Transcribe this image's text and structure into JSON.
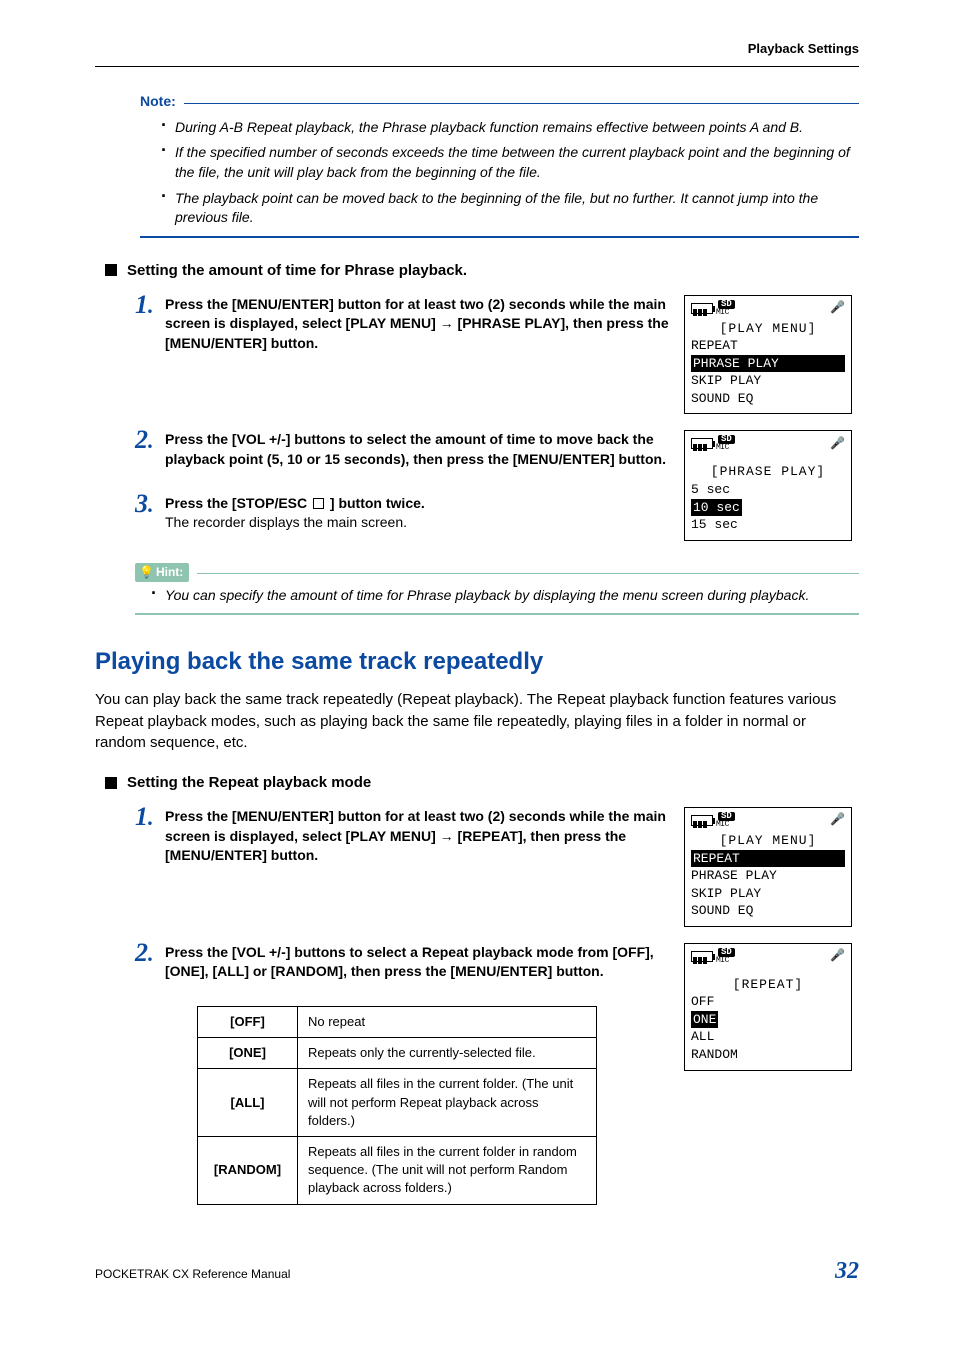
{
  "header": {
    "section": "Playback Settings"
  },
  "note": {
    "label": "Note:",
    "items": [
      "During A-B Repeat playback, the Phrase playback function remains effective between points A and B.",
      "If the specified number of seconds exceeds the time between the current playback point and the beginning of the file, the unit will play back from the beginning of the file.",
      "The playback point can be moved back to the beginning of the file, but no further. It cannot jump into the previous file."
    ]
  },
  "phrase": {
    "heading": "Setting the amount of time for Phrase playback.",
    "steps": [
      {
        "n": "1",
        "bold": "Press the [MENU/ENTER] button for at least two (2) seconds while the main screen is displayed, select [PLAY MENU] → [PHRASE PLAY], then press the [MENU/ENTER] button."
      },
      {
        "n": "2",
        "bold": "Press the [VOL +/-] buttons to select the amount of time to move back the playback point (5, 10 or 15 seconds), then press the [MENU/ENTER] button."
      },
      {
        "n": "3",
        "bold_a": "Press the [STOP/ESC ",
        "bold_b": " ] button twice.",
        "plain": "The recorder displays the main screen."
      }
    ],
    "lcd1": {
      "title": "[PLAY MENU]",
      "lines": [
        "REPEAT",
        "PHRASE PLAY",
        "SKIP PLAY",
        "SOUND EQ"
      ],
      "selected": 1
    },
    "lcd2": {
      "title": "[PHRASE PLAY]",
      "lines": [
        "5 sec",
        "10 sec",
        "15 sec"
      ],
      "selected": 1
    }
  },
  "hint": {
    "label": "Hint:",
    "items": [
      "You can specify the amount of time for Phrase playback by displaying the menu screen during playback."
    ]
  },
  "repeat": {
    "title": "Playing back the same track repeatedly",
    "intro": "You can play back the same track repeatedly (Repeat playback). The Repeat playback function features various Repeat playback modes, such as playing back the same file repeatedly, playing files in a folder in normal or random sequence, etc.",
    "heading": "Setting the Repeat playback mode",
    "steps": [
      {
        "n": "1",
        "bold": "Press the [MENU/ENTER] button for at least two (2) seconds while the main screen is displayed, select [PLAY MENU] → [REPEAT], then press the [MENU/ENTER] button."
      },
      {
        "n": "2",
        "bold": "Press the [VOL +/-] buttons to select a Repeat playback mode from [OFF], [ONE], [ALL] or [RANDOM], then press the [MENU/ENTER] button."
      }
    ],
    "table": [
      {
        "m": "[OFF]",
        "d": "No repeat"
      },
      {
        "m": "[ONE]",
        "d": "Repeats only the currently-selected file."
      },
      {
        "m": "[ALL]",
        "d": "Repeats all files in the current folder. (The unit will not perform Repeat playback across folders.)"
      },
      {
        "m": "[RANDOM]",
        "d": "Repeats all files in the current folder in random sequence. (The unit will not perform Random playback across folders.)"
      }
    ],
    "lcd1": {
      "title": "[PLAY MENU]",
      "lines": [
        "REPEAT",
        "PHRASE PLAY",
        "SKIP PLAY",
        "SOUND EQ"
      ],
      "selected": 0
    },
    "lcd2": {
      "title": "[REPEAT]",
      "lines": [
        "OFF",
        "ONE",
        "ALL",
        "RANDOM"
      ],
      "selected": 1
    }
  },
  "footer": {
    "left": "POCKETRAK CX   Reference Manual",
    "page": "32"
  },
  "icons": {
    "sd": "SD",
    "mic": "MIC"
  }
}
